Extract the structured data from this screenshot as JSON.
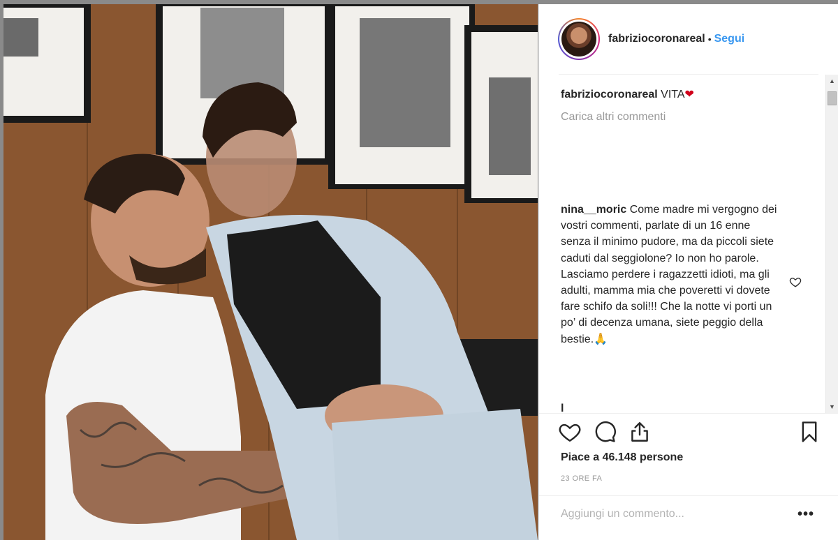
{
  "post": {
    "username": "fabriziocoronareal",
    "separator": "•",
    "follow_label": "Segui",
    "caption_text": " VITA",
    "caption_emoji": "❤",
    "load_more_label": "Carica altri commenti",
    "comments": [
      {
        "username": "nina__moric",
        "text": " Come madre mi vergogno dei vostri commenti, parlate di un 16 enne senza il minimo pudore, ma da piccoli siete caduti dal seggiolone? Io non ho parole. Lasciamo perdere i ragazzetti idioti, ma gli adulti, mamma mia che poveretti vi dovete fare schifo da soli!!! Che la notte vi porti un po’ di decenza umana, siete peggio della bestie.🙏"
      }
    ],
    "partial_comment": "l",
    "likes_label": "Piace a 46.148 persone",
    "time_label": "23 ORE FA",
    "add_comment_placeholder": "Aggiungi un commento...",
    "more_label": "•••"
  },
  "icons": {
    "like": "heart-icon",
    "comment": "comment-bubble-icon",
    "share": "share-icon",
    "save": "bookmark-icon",
    "comment_like": "small-heart-icon"
  },
  "colors": {
    "link": "#3897f0",
    "text": "#262626",
    "muted": "#999999",
    "heart": "#d0021b"
  }
}
